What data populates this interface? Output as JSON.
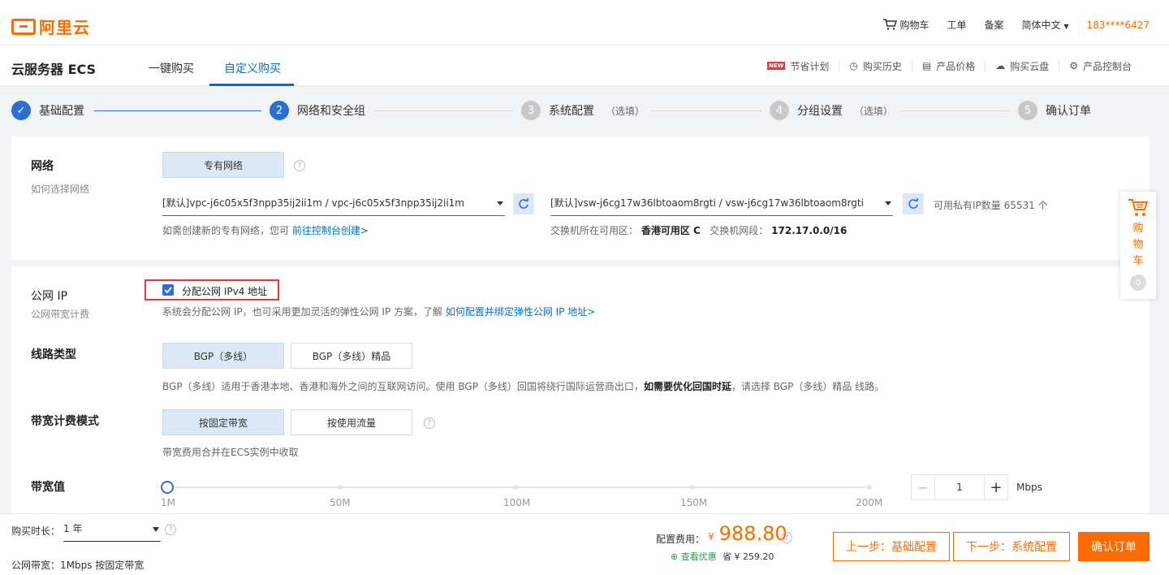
{
  "header": {
    "logo_text": "阿里云",
    "cart_label": "购物车",
    "ticket_label": "工单",
    "filing_label": "备案",
    "language_label": "简体中文",
    "phone": "183****6427"
  },
  "product": {
    "title": "云服务器 ECS",
    "tabs": [
      {
        "label": "一键购买"
      },
      {
        "label": "自定义购买",
        "active": true
      }
    ],
    "links": [
      {
        "label": "节省计划",
        "tag": "NEW"
      },
      {
        "label": "购买历史"
      },
      {
        "label": "产品价格"
      },
      {
        "label": "购买云盘"
      },
      {
        "label": "产品控制台"
      }
    ]
  },
  "steps": [
    {
      "label": "基础配置",
      "state": "done",
      "num": ""
    },
    {
      "label": "网络和安全组",
      "state": "active",
      "num": "2"
    },
    {
      "label": "系统配置",
      "state": "todo",
      "num": "3",
      "optional": "（选填）"
    },
    {
      "label": "分组设置",
      "state": "todo",
      "num": "4",
      "optional": "（选填）"
    },
    {
      "label": "确认订单",
      "state": "todo",
      "num": "5"
    }
  ],
  "network": {
    "label": "网络",
    "sublabel": "如何选择网络",
    "type_option": "专有网络",
    "vpc_value": "[默认]vpc-j6c05x5f3npp35ij2ii1m / vpc-j6c05x5f3npp35ij2ii1m",
    "vswitch_value": "[默认]vsw-j6cg17w36lbtoaom8rgti / vsw-j6cg17w36lbtoaom8rgti",
    "available_ip": "可用私有IP数量 65531 个",
    "vpc_hint": "如需创建新的专有网络，您可",
    "vpc_hint_link": "前往控制台创建>",
    "zone_hint_label": "交换机所在可用区：",
    "zone_value": "香港可用区 C",
    "cidr_hint_label": "交换机网段：",
    "cidr_value": "172.17.0.0/16"
  },
  "public_ip": {
    "label": "公网 IP",
    "sublabel": "公网带宽计费",
    "checkbox_label": "分配公网 IPv4 地址",
    "checked": true,
    "hint": "系统会分配公网 IP，也可采用更加灵活的弹性公网 IP 方案，了解",
    "hint_link": "如何配置并绑定弹性公网 IP 地址>"
  },
  "line_type": {
    "label": "线路类型",
    "options": [
      "BGP（多线）",
      "BGP（多线）精品"
    ],
    "selected": "BGP（多线）",
    "hint_pre": "BGP（多线）适用于香港本地、香港和海外之间的互联网访问。使用 BGP（多线）回国将绕行国际运营商出口，",
    "hint_bold": "如需要优化回国时延",
    "hint_post": "，请选择 BGP（多线）精品 线路。"
  },
  "billing": {
    "label": "带宽计费模式",
    "options": [
      "按固定带宽",
      "按使用流量"
    ],
    "selected": "按固定带宽",
    "hint": "带宽费用合并在ECS实例中收取"
  },
  "bandwidth": {
    "label": "带宽值",
    "ticks": [
      "1M",
      "50M",
      "100M",
      "150M",
      "200M"
    ],
    "value": "1",
    "value_fraction": 0,
    "unit": "Mbps",
    "minus": "−",
    "plus": "+"
  },
  "float_cart": {
    "label_1": "购",
    "label_2": "物",
    "label_3": "车",
    "count": "0"
  },
  "footer": {
    "duration_label": "购买时长：",
    "duration_value": "1 年",
    "bandwidth_summary": "公网带宽：1Mbps 按固定带宽",
    "price_label": "配置费用：",
    "currency": "¥",
    "price": "988.80",
    "discount_label": "查看优惠",
    "save_label": "省 ¥ 259.20",
    "prev_button": "上一步：基础配置",
    "next_button": "下一步：系统配置",
    "confirm_button": "确认订单"
  },
  "colors": {
    "brand_orange": "#ff6a00",
    "primary_blue": "#2b6fd6",
    "link_blue": "#0070cc",
    "highlight_red": "#e4393c"
  }
}
